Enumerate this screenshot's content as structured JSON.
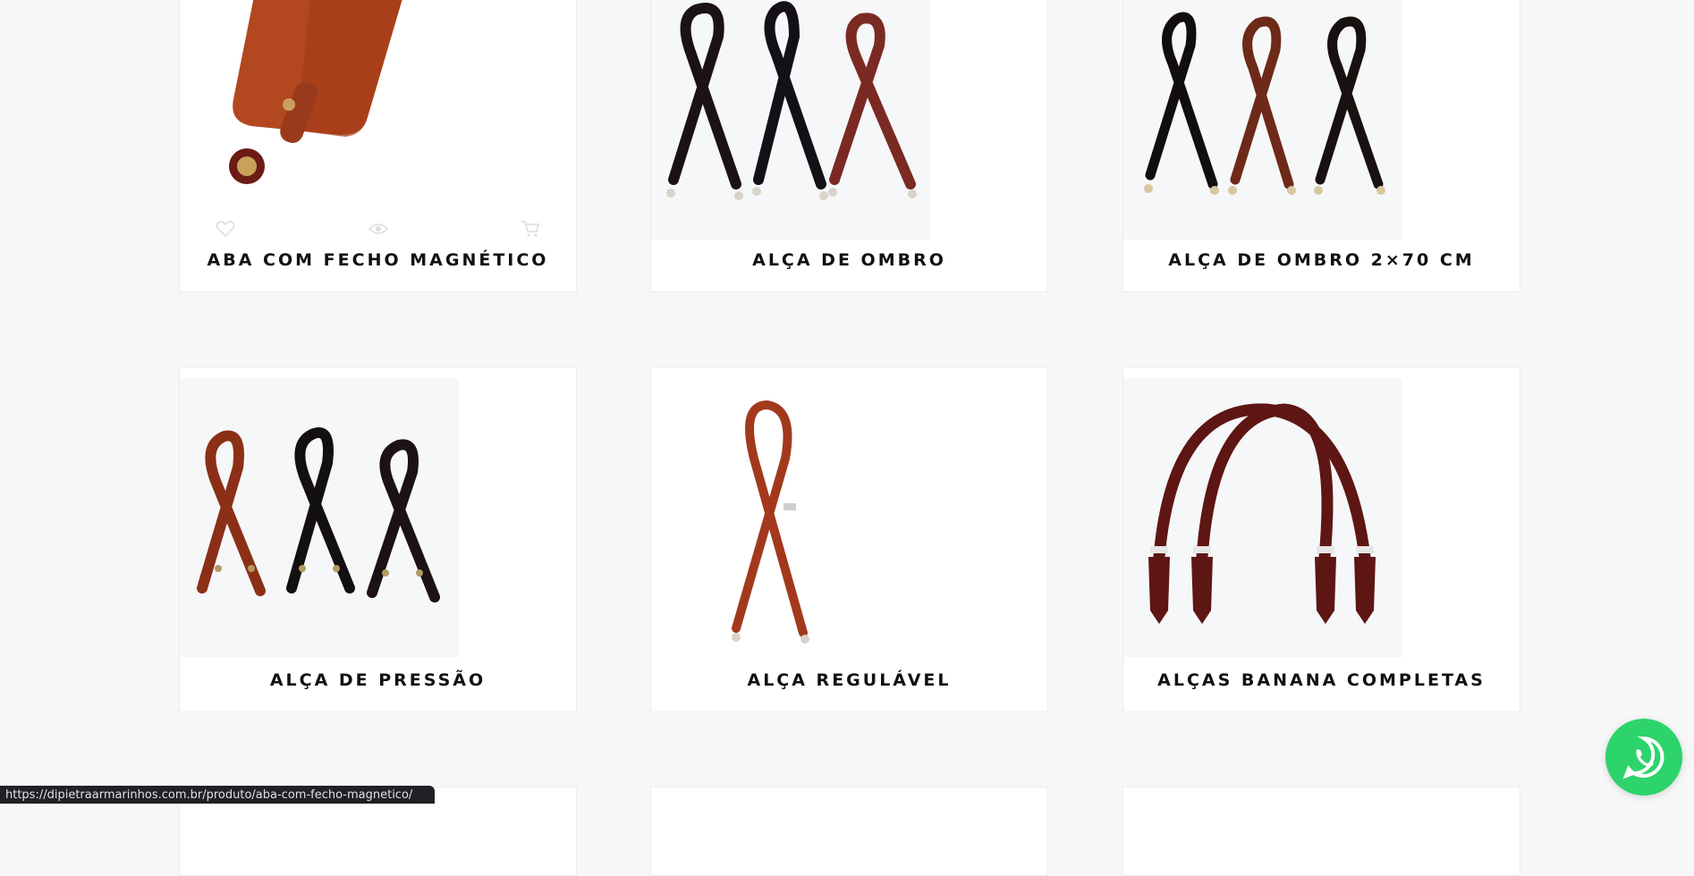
{
  "products": [
    {
      "title": "ABA COM FECHO MAGNÉTICO"
    },
    {
      "title": "ALÇA DE OMBRO"
    },
    {
      "title": "ALÇA DE OMBRO 2×70 CM"
    },
    {
      "title": "ALÇA DE PRESSÃO"
    },
    {
      "title": "ALÇA REGULÁVEL"
    },
    {
      "title": "ALÇAS BANANA COMPLETAS"
    }
  ],
  "product_actions": {
    "icons": [
      "heart-icon",
      "eye-icon",
      "cart-icon"
    ]
  },
  "status_bar": {
    "url": "https://dipietraarmarinhos.com.br/produto/aba-com-fecho-magnetico/"
  },
  "colors": {
    "page_bg": "#f7f7f7",
    "card_bg": "#ffffff",
    "whatsapp_green": "#2cd46b",
    "leather_brown": "#9a3a1c",
    "leather_black": "#1b1214"
  }
}
